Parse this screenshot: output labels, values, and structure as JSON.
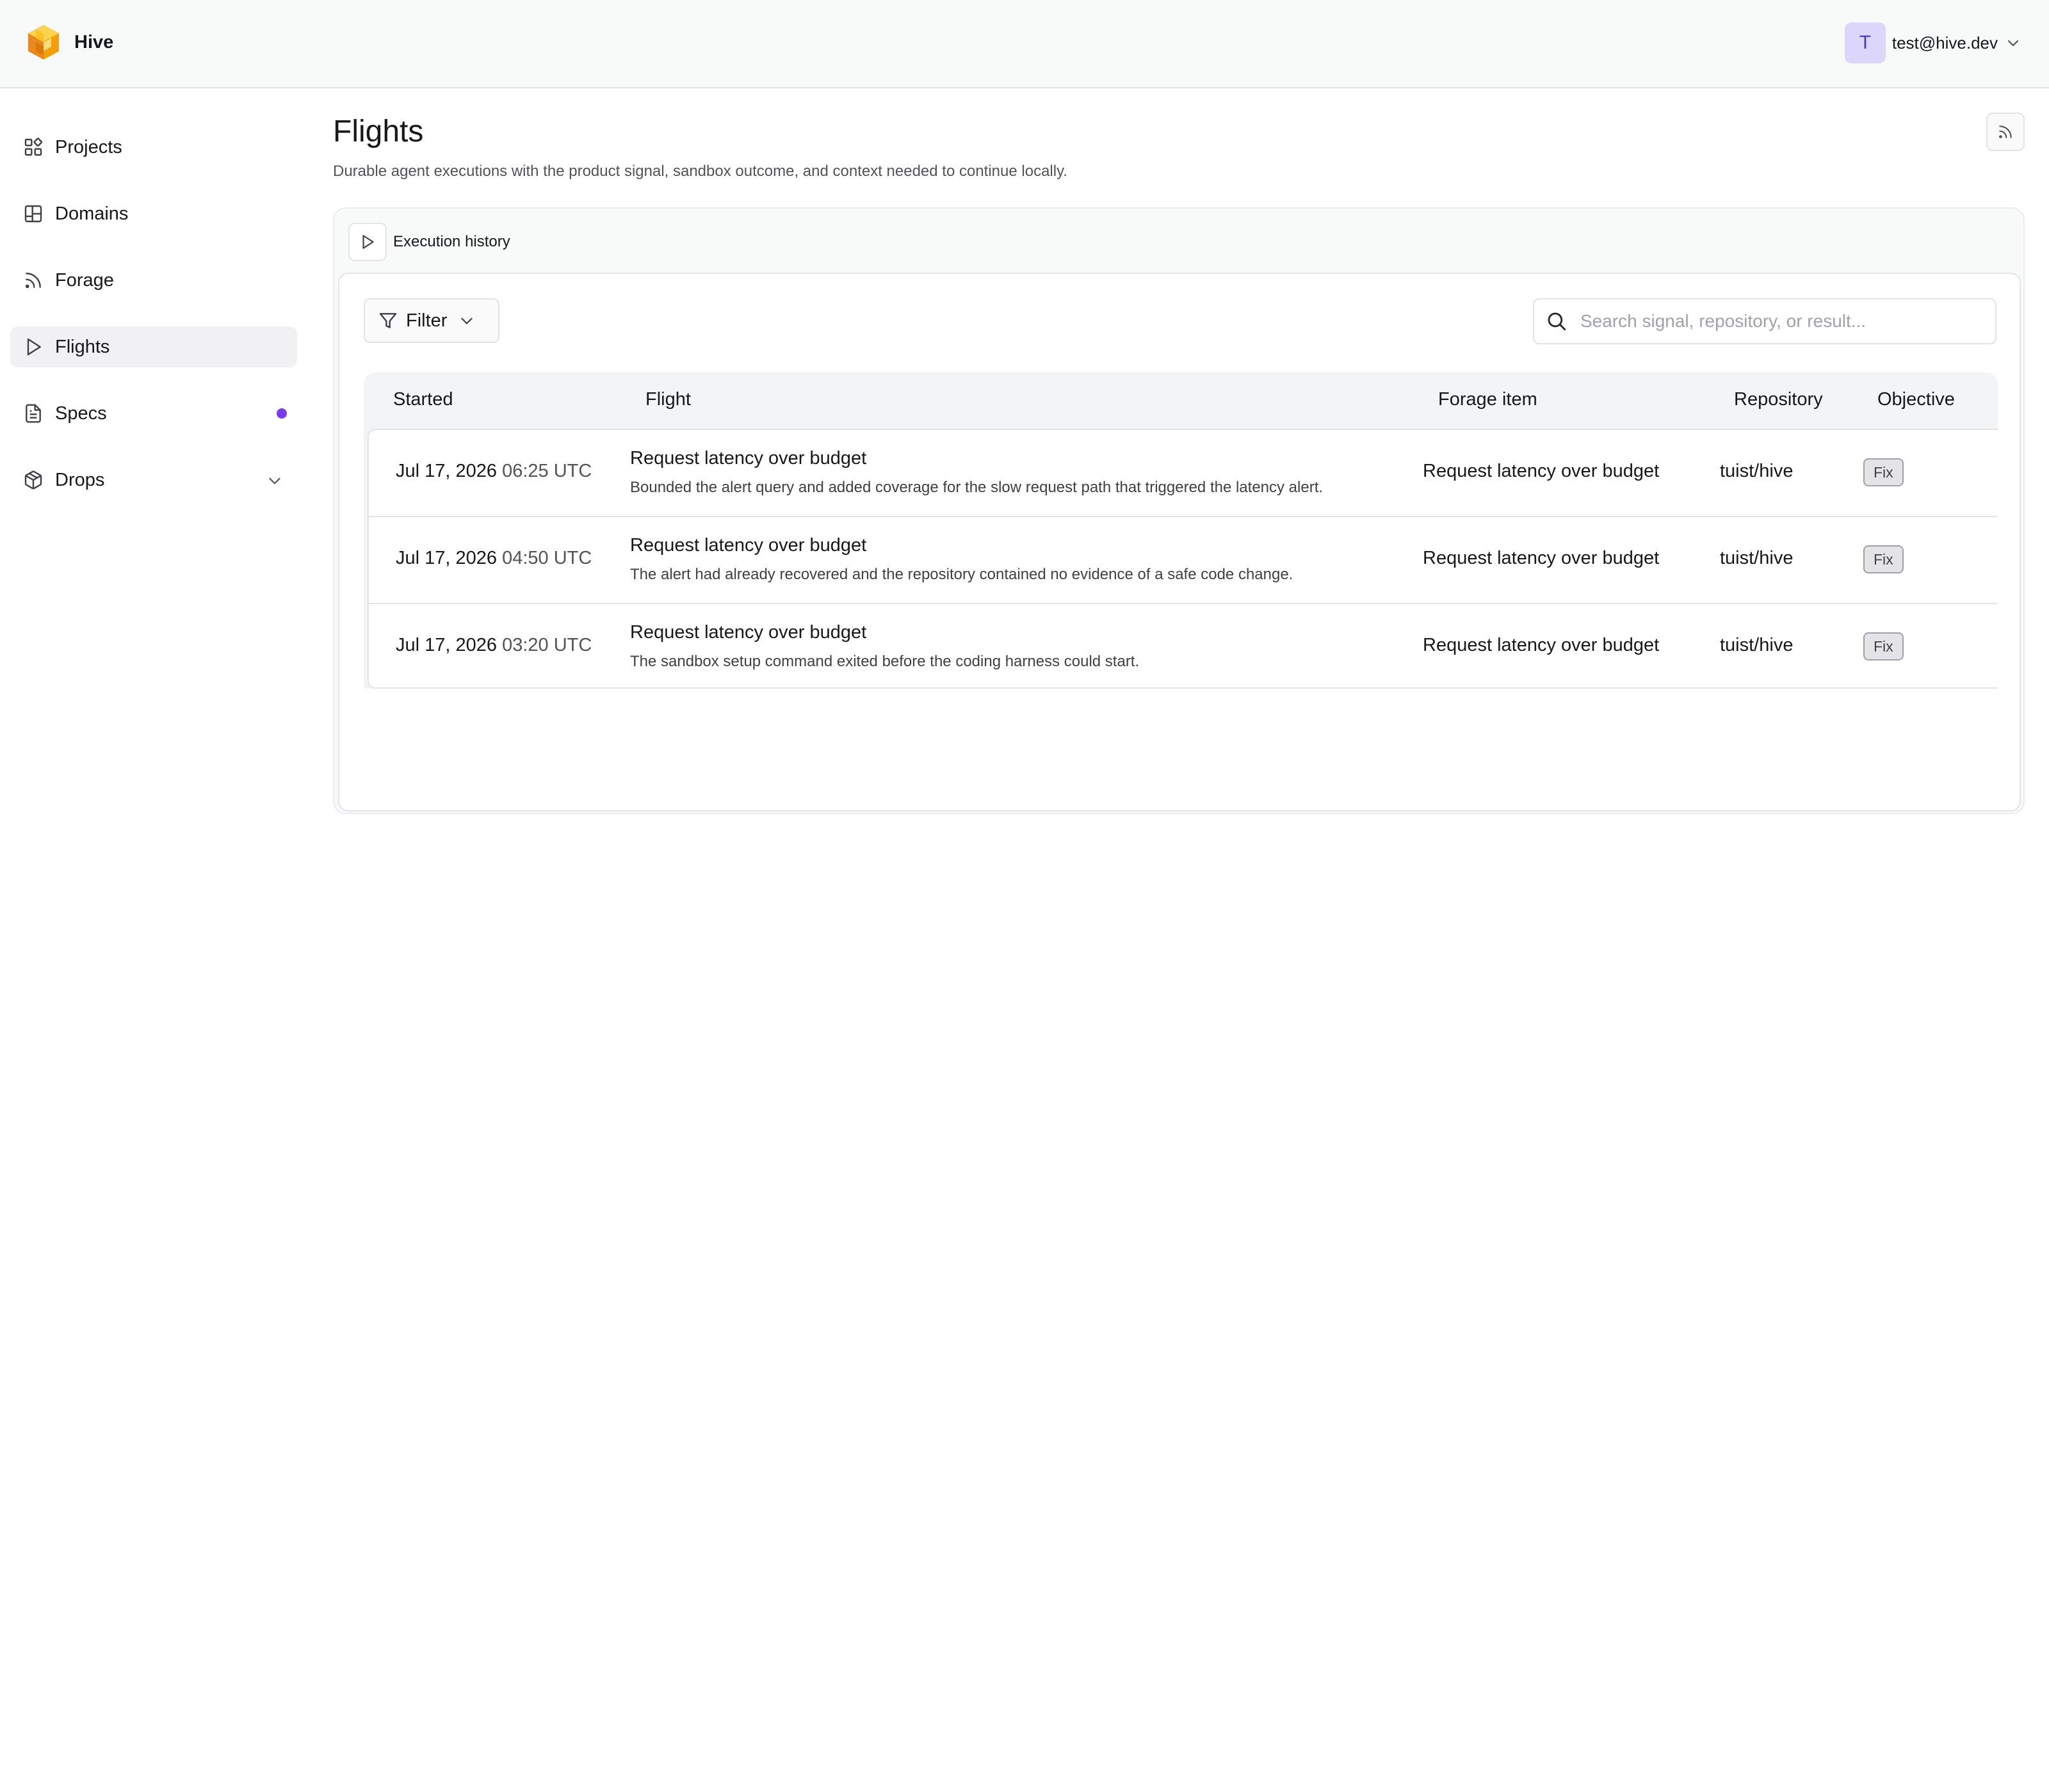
{
  "app": {
    "name": "Hive"
  },
  "account": {
    "avatar_initial": "T",
    "email": "test@hive.dev"
  },
  "sidebar": {
    "items": [
      {
        "label": "Projects",
        "icon": "projects-icon"
      },
      {
        "label": "Domains",
        "icon": "domains-icon"
      },
      {
        "label": "Forage",
        "icon": "rss-icon"
      },
      {
        "label": "Flights",
        "icon": "play-icon",
        "active": true
      },
      {
        "label": "Specs",
        "icon": "document-icon",
        "has_notification_dot": true
      },
      {
        "label": "Drops",
        "icon": "package-icon",
        "expandable": true
      }
    ]
  },
  "page": {
    "title": "Flights",
    "subtitle": "Durable agent executions with the product signal, sandbox outcome, and context needed to continue locally."
  },
  "panel": {
    "tab_label": "Execution history"
  },
  "toolbar": {
    "filter_label": "Filter",
    "search_placeholder": "Search signal, repository, or result..."
  },
  "table": {
    "headers": {
      "started": "Started",
      "flight": "Flight",
      "forage_item": "Forage item",
      "repository": "Repository",
      "objective": "Objective"
    },
    "rows": [
      {
        "date": "Jul 17, 2026",
        "time": "06:25 UTC",
        "flight_title": "Request latency over budget",
        "flight_description": "Bounded the alert query and added coverage for the slow request path that triggered the latency alert.",
        "forage_item": "Request latency over budget",
        "repository": "tuist/hive",
        "objective": "Fix"
      },
      {
        "date": "Jul 17, 2026",
        "time": "04:50 UTC",
        "flight_title": "Request latency over budget",
        "flight_description": "The alert had already recovered and the repository contained no evidence of a safe code change.",
        "forage_item": "Request latency over budget",
        "repository": "tuist/hive",
        "objective": "Fix"
      },
      {
        "date": "Jul 17, 2026",
        "time": "03:20 UTC",
        "flight_title": "Request latency over budget",
        "flight_description": "The sandbox setup command exited before the coding harness could start.",
        "forage_item": "Request latency over budget",
        "repository": "tuist/hive",
        "objective": "Fix"
      }
    ]
  },
  "colors": {
    "accent_dot": "#7c3aed",
    "avatar_bg": "#dcd6fb",
    "logo": "#f5b324"
  }
}
